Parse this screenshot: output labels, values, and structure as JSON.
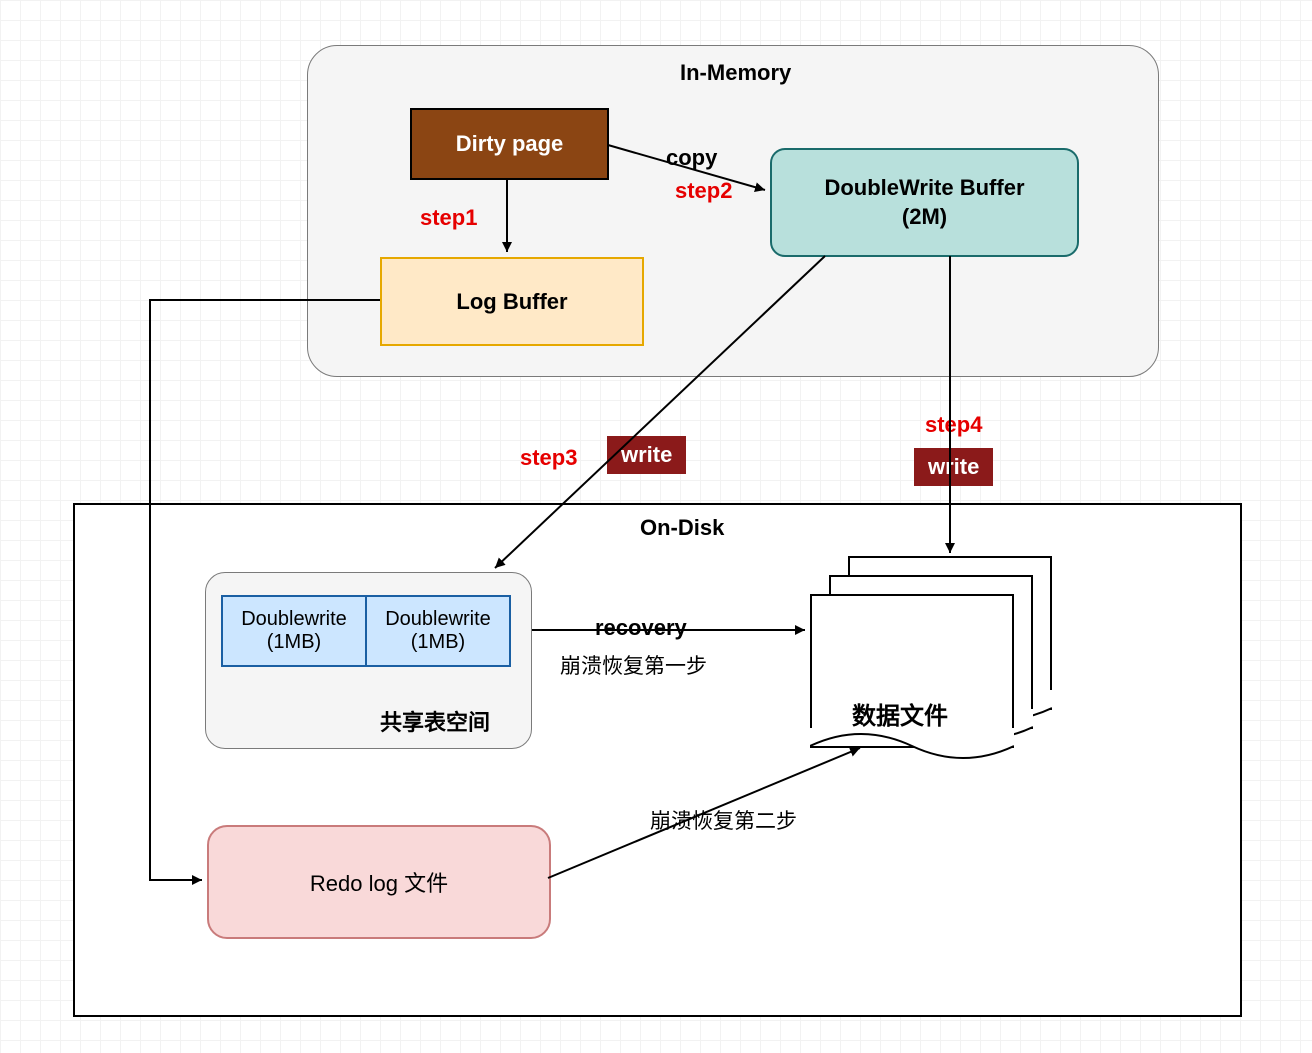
{
  "in_memory": {
    "title": "In-Memory",
    "dirty_page": "Dirty page",
    "doublewrite_buffer_line1": "DoubleWrite Buffer",
    "doublewrite_buffer_line2": "(2M)",
    "log_buffer": "Log Buffer"
  },
  "on_disk": {
    "title": "On-Disk",
    "shared_tablespace_label": "共享表空间",
    "dw1_line1": "Doublewrite",
    "dw1_line2": "(1MB)",
    "dw2_line1": "Doublewrite",
    "dw2_line2": "(1MB)",
    "redo_log": "Redo log 文件",
    "data_file": "数据文件"
  },
  "steps": {
    "step1": "step1",
    "step2": "step2",
    "step3": "step3",
    "step4": "step4"
  },
  "labels": {
    "copy": "copy",
    "write1": "write",
    "write2": "write",
    "recovery": "recovery",
    "recovery_sub": "崩溃恢复第一步",
    "recovery2_sub": "崩溃恢复第二步"
  }
}
